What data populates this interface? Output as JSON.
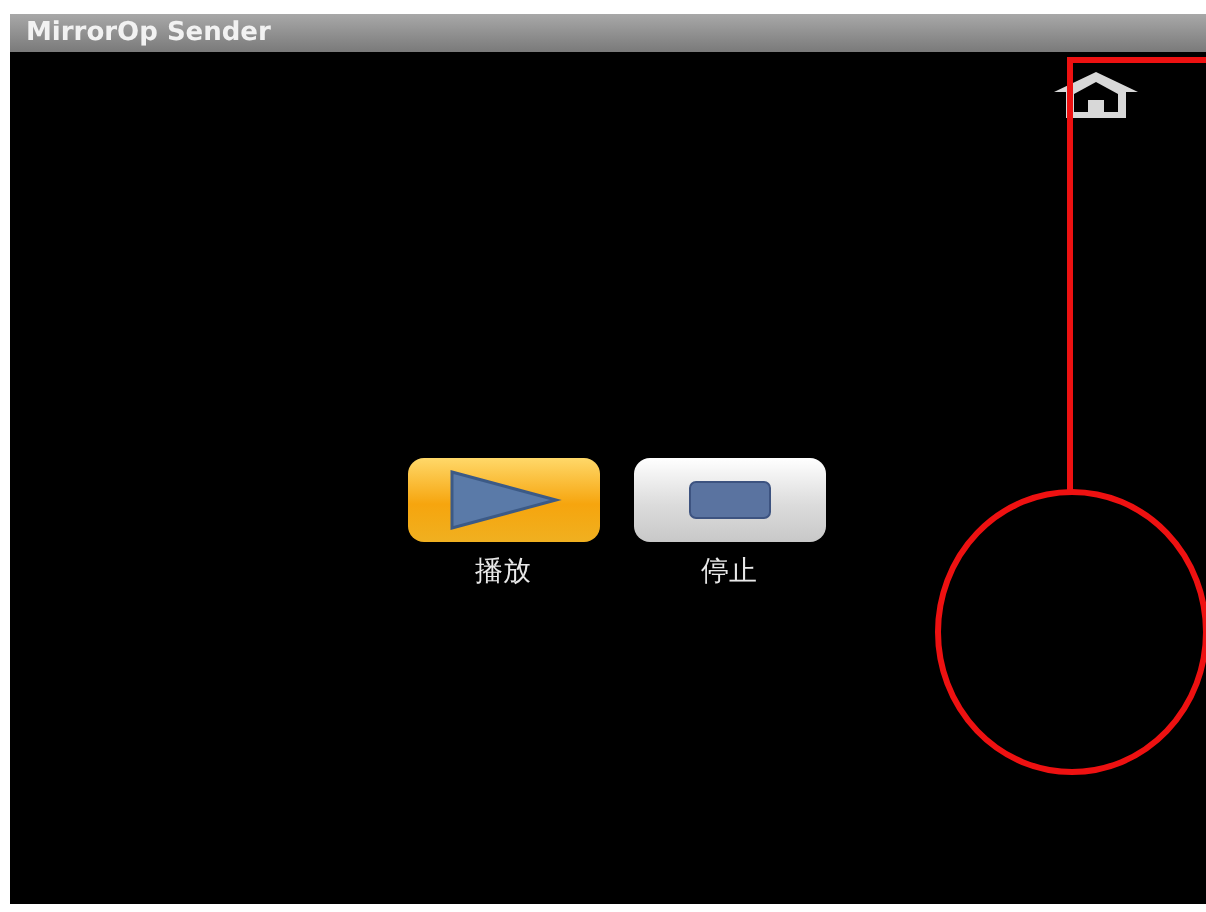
{
  "window": {
    "title": "MirrorOp Sender"
  },
  "buttons": [
    {
      "kind": "play",
      "label": "播放"
    },
    {
      "kind": "stop",
      "label": "停止"
    }
  ]
}
